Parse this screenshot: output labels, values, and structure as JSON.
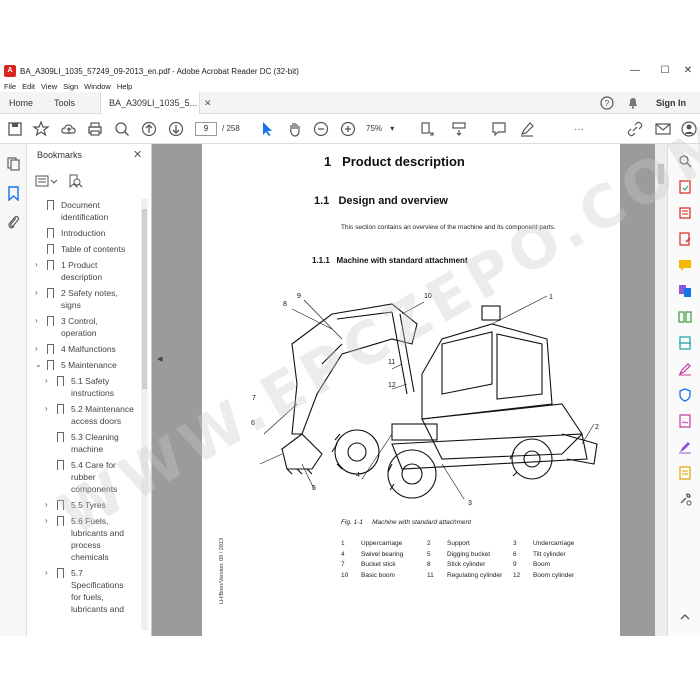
{
  "window": {
    "title": "BA_A309LI_1035_57249_09-2013_en.pdf - Adobe Acrobat Reader DC (32-bit)",
    "minimize": "—",
    "maximize": "☐",
    "close": "✕"
  },
  "menu": [
    "File",
    "Edit",
    "View",
    "Sign",
    "Window",
    "Help"
  ],
  "tabs": {
    "home": "Home",
    "tools": "Tools",
    "document": "BA_A309LI_1035_5...",
    "close": "✕",
    "sign_in": "Sign In"
  },
  "toolbar": {
    "page_current": "9",
    "page_total": "/ 258",
    "zoom": "75%",
    "more": "···"
  },
  "bookmarks": {
    "header": "Bookmarks",
    "close": "✕",
    "items": [
      {
        "lines": [
          "Document",
          "identification"
        ],
        "level": 0,
        "caret": ""
      },
      {
        "lines": [
          "Introduction"
        ],
        "level": 0,
        "caret": ""
      },
      {
        "lines": [
          "Table of contents"
        ],
        "level": 0,
        "caret": ""
      },
      {
        "lines": [
          "1 Product",
          "description"
        ],
        "level": 0,
        "caret": "›"
      },
      {
        "lines": [
          "2 Safety notes,",
          "signs"
        ],
        "level": 0,
        "caret": "›"
      },
      {
        "lines": [
          "3 Control,",
          "operation"
        ],
        "level": 0,
        "caret": "›"
      },
      {
        "lines": [
          "4 Malfunctions"
        ],
        "level": 0,
        "caret": "›"
      },
      {
        "lines": [
          "5 Maintenance"
        ],
        "level": 0,
        "caret": "⌄"
      },
      {
        "lines": [
          "5.1 Safety",
          "instructions"
        ],
        "level": 1,
        "caret": "›"
      },
      {
        "lines": [
          "5.2 Maintenance",
          "access doors"
        ],
        "level": 1,
        "caret": "›"
      },
      {
        "lines": [
          "5.3 Cleaning",
          "machine"
        ],
        "level": 1,
        "caret": ""
      },
      {
        "lines": [
          "5.4 Care for",
          "rubber",
          "components"
        ],
        "level": 1,
        "caret": ""
      },
      {
        "lines": [
          "5.5 Tyres"
        ],
        "level": 1,
        "caret": "›"
      },
      {
        "lines": [
          "5.6 Fuels,",
          "lubricants and",
          "process",
          "chemicals"
        ],
        "level": 1,
        "caret": "›"
      },
      {
        "lines": [
          "5.7",
          "Specifications",
          "for fuels,",
          "lubricants and"
        ],
        "level": 1,
        "caret": "›"
      }
    ]
  },
  "document": {
    "h1_num": "1",
    "h1": "Product description",
    "h2_num": "1.1",
    "h2": "Design and overview",
    "intro": "This section contains an overview of the machine and its component parts.",
    "h3_num": "1.1.1",
    "h3": "Machine with standard attachment",
    "fig_num": "Fig. 1-1",
    "fig_caption": "Machine with standard attachment",
    "callouts": [
      "1",
      "2",
      "3",
      "4",
      "5",
      "6",
      "7",
      "8",
      "9",
      "10",
      "11",
      "12"
    ],
    "legend": [
      [
        "1",
        "Uppercarriage",
        "2",
        "Support",
        "3",
        "Undercarriage"
      ],
      [
        "4",
        "Swivel bearing",
        "5",
        "Digging bucket",
        "6",
        "Tilt cylinder"
      ],
      [
        "7",
        "Bucket stick",
        "8",
        "Stick cylinder",
        "9",
        "Boom"
      ],
      [
        "10",
        "Basic boom",
        "11",
        "Regulating cylinder",
        "12",
        "Boom cylinder"
      ]
    ],
    "side_note": "LH/Bren/Version: 09 / 2013"
  },
  "watermark": "WWW.EPCZEPO.COM",
  "colors": {
    "accent": "#1473e6",
    "acrobat_red": "#d7261e",
    "viewer_bg": "#9b9b9b"
  }
}
